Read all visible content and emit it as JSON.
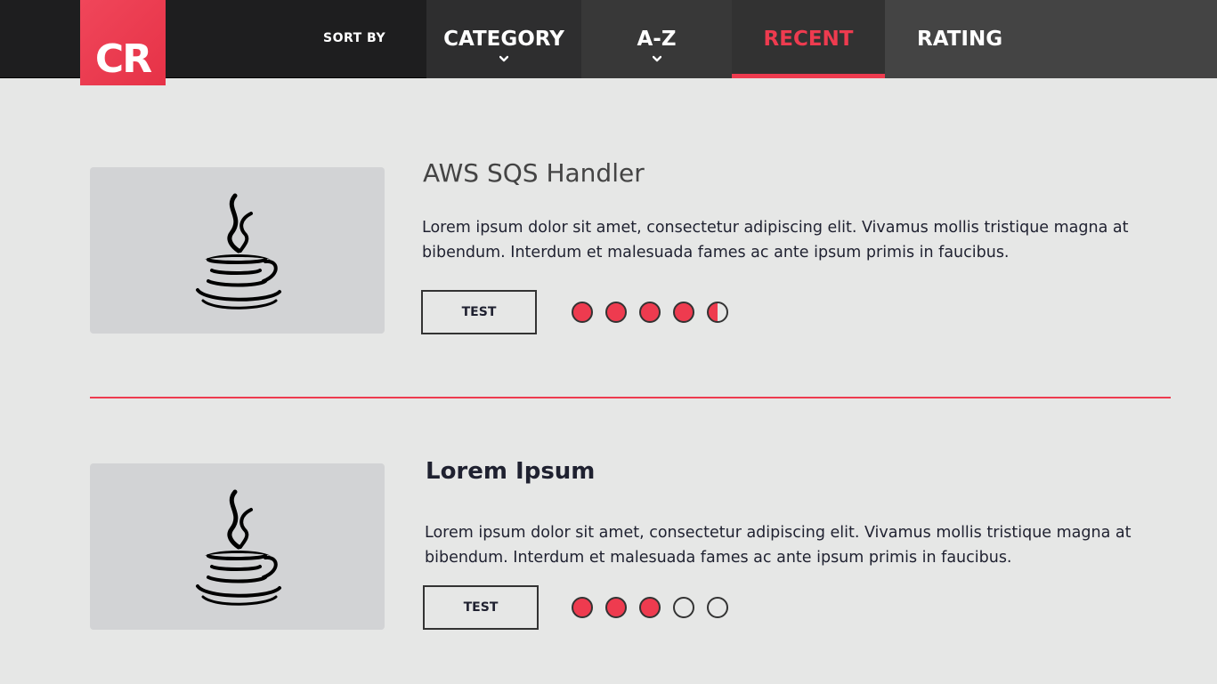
{
  "header": {
    "logo_text": "CR",
    "sort_label": "SORT BY",
    "tabs": [
      {
        "label": "CATEGORY",
        "has_dropdown": true
      },
      {
        "label": "A-Z",
        "has_dropdown": true
      },
      {
        "label": "RECENT",
        "active": true
      },
      {
        "label": "RATING"
      }
    ]
  },
  "cards": [
    {
      "icon": "java-icon",
      "title": "AWS SQS Handler",
      "description": "Lorem ipsum dolor sit amet, consectetur adipiscing elit. Vivamus mollis tristique magna at bibendum. Interdum et malesuada fames ac ante ipsum primis in faucibus.",
      "button_label": "TEST",
      "rating": 4.5,
      "rating_max": 5
    },
    {
      "icon": "java-icon",
      "title": "Lorem Ipsum",
      "description": "Lorem ipsum dolor sit amet, consectetur adipiscing elit. Vivamus mollis tristique magna at bibendum. Interdum et malesuada fames ac ante ipsum primis in faucibus.",
      "button_label": "TEST",
      "rating": 3,
      "rating_max": 5
    }
  ],
  "colors": {
    "accent": "#ee3b4f",
    "nav_bg": "#1e1e1f",
    "page_bg": "#e6e7e6"
  }
}
